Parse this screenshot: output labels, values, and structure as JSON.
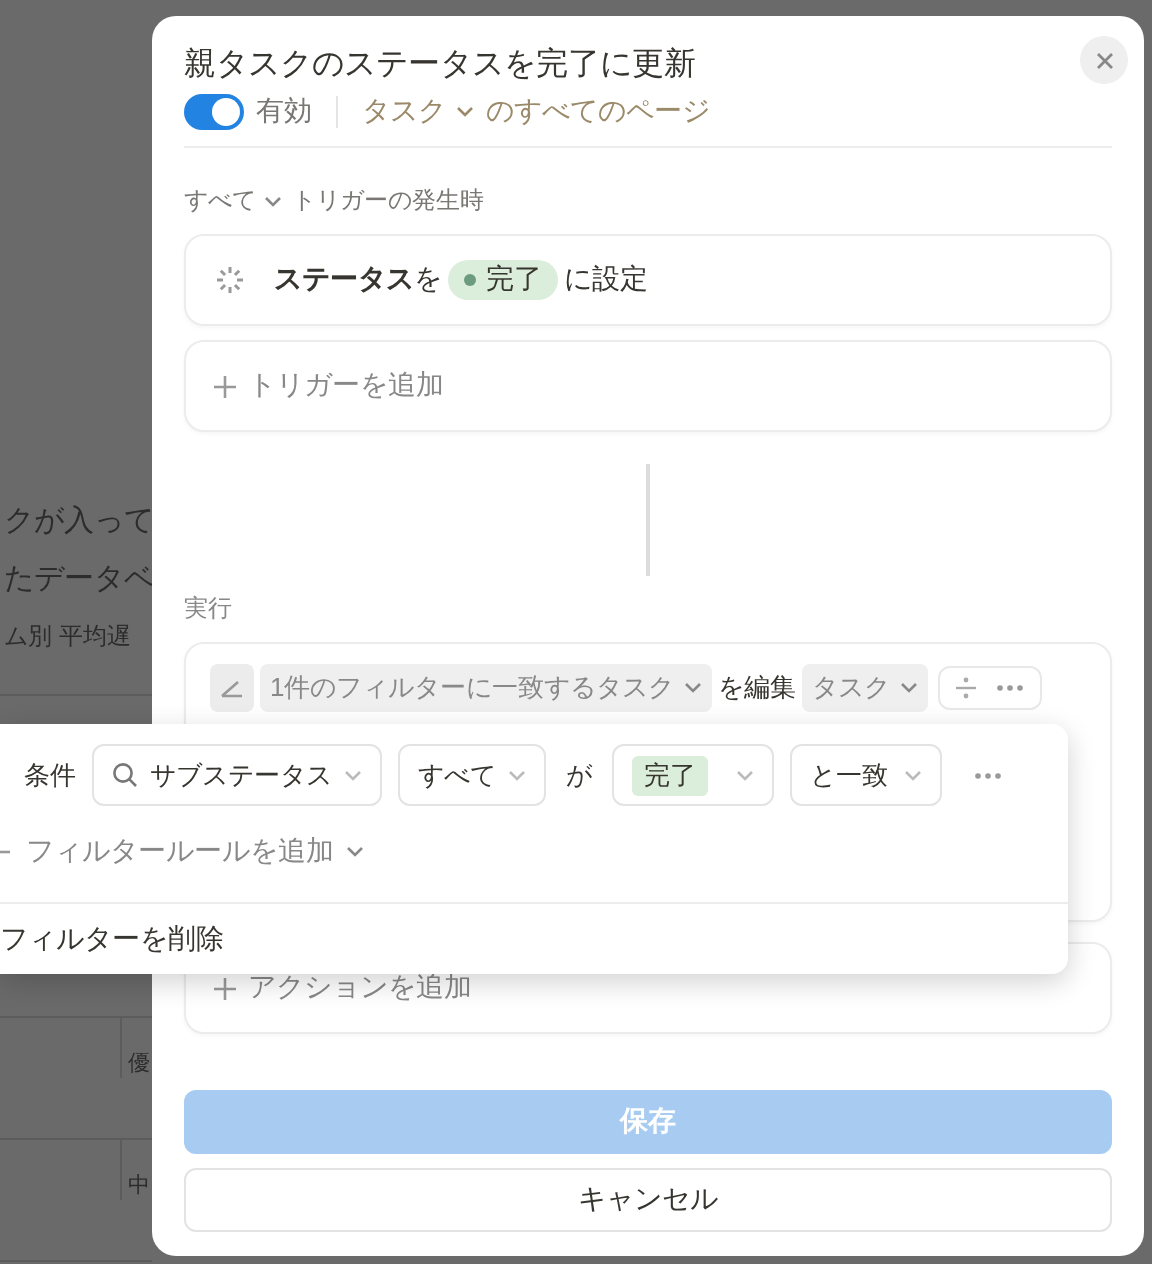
{
  "background": {
    "texts": [
      "クが入って",
      "たデータベ",
      "ム別 平均遅"
    ],
    "table_cells": [
      "優",
      "中"
    ]
  },
  "dialog": {
    "title": "親タスクのステータスを完了に更新",
    "enabled": {
      "label": "有効",
      "on": true
    },
    "scope": {
      "database": "タスク",
      "suffix": "のすべてのページ"
    },
    "trigger_section": {
      "mode": "すべて",
      "label": "トリガーの発生時"
    },
    "triggers": [
      {
        "property": "ステータス",
        "particle": "を",
        "value": "完了",
        "suffix": "に設定"
      }
    ],
    "add_trigger": "トリガーを追加",
    "actions_label": "実行",
    "action": {
      "filter": "1件のフィルターに一致するタスク",
      "verb": "を編集",
      "database": "タスク"
    },
    "add_action": "アクションを追加",
    "buttons": [
      {
        "label": "保存",
        "kind": "primary",
        "disabled": true
      },
      {
        "label": "キャンセル",
        "kind": "secondary",
        "disabled": false
      }
    ]
  },
  "filter_popover": {
    "label": "条件",
    "rule": {
      "property": "サブステータス",
      "quantifier": "すべて",
      "particle": "が",
      "value": "完了",
      "operator": "と一致"
    },
    "add_rule": "フィルタールールを追加",
    "delete": "フィルターを削除"
  }
}
